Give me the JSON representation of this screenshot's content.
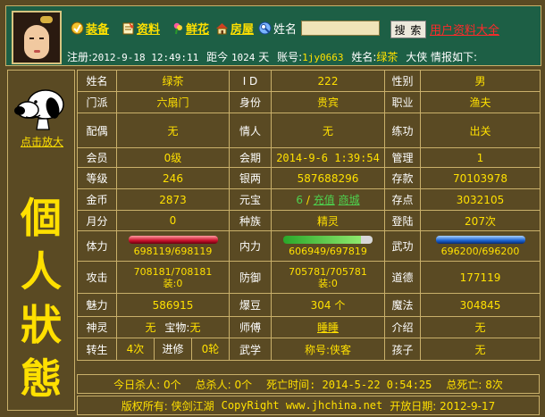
{
  "nav": [
    {
      "label": "装备",
      "icon": "equipment-icon"
    },
    {
      "label": "资料",
      "icon": "profile-icon"
    },
    {
      "label": "鲜花",
      "icon": "flower-icon"
    },
    {
      "label": "房屋",
      "icon": "house-icon"
    }
  ],
  "search": {
    "label": "姓名",
    "button": "搜 索",
    "link": "用户资料大全"
  },
  "reg": {
    "prefix": "注册:",
    "date": "2012-9-18 12:49:11",
    "since": "距今",
    "days": "1024",
    "days_unit": "天",
    "account_label": "账号:",
    "account": "1jy0663",
    "name_label": "姓名:",
    "name": "绿茶",
    "suffix": "大侠 情报如下:"
  },
  "sidebar": {
    "enlarge": "点击放大",
    "title": [
      "個",
      "人",
      "狀",
      "態"
    ]
  },
  "rows": [
    {
      "cells": [
        {
          "l": "姓名",
          "v": "绿茶"
        },
        {
          "l": "I D",
          "v": "222"
        },
        {
          "l": "性别",
          "v": "男"
        }
      ]
    },
    {
      "cells": [
        {
          "l": "门派",
          "v": "六扇门"
        },
        {
          "l": "身份",
          "v": "贵宾"
        },
        {
          "l": "职业",
          "v": "渔夫"
        }
      ]
    },
    {
      "cells": [
        {
          "l": "配偶",
          "v": "无"
        },
        {
          "l": "情人",
          "v": "无"
        },
        {
          "l": "练功",
          "v": "出关"
        }
      ]
    },
    {
      "cells": [
        {
          "l": "会员",
          "v": "0级"
        },
        {
          "l": "会期",
          "v": "2014-9-6 1:39:54"
        },
        {
          "l": "管理",
          "v": "1"
        }
      ]
    },
    {
      "cells": [
        {
          "l": "等级",
          "v": "246"
        },
        {
          "l": "银两",
          "v": "587688296"
        },
        {
          "l": "存款",
          "v": "70103978"
        }
      ]
    },
    {
      "cells": [
        {
          "l": "金币",
          "v": "2873"
        },
        {
          "l": "元宝",
          "v": "6"
        },
        {
          "l": "存点",
          "v": "3032105"
        }
      ]
    },
    {
      "cells": [
        {
          "l": "月分",
          "v": "0"
        },
        {
          "l": "种族",
          "v": "精灵"
        },
        {
          "l": "登陆",
          "v": "207次"
        }
      ]
    }
  ],
  "yuanbao_links": {
    "recharge": "充值",
    "mall": "商城"
  },
  "bars": [
    {
      "label": "体力",
      "current": 698119,
      "max": 698119,
      "text": "698119/698119",
      "color": "#c8102a"
    },
    {
      "label": "内力",
      "current": 606949,
      "max": 697819,
      "text": "606949/697819",
      "color": "#4ed24e"
    },
    {
      "label": "武功",
      "current": 696200,
      "max": 696200,
      "text": "696200/696200",
      "color": "#1a62d0"
    }
  ],
  "rows2": [
    {
      "cells": [
        {
          "l": "攻击",
          "v": "708181/708181",
          "v2": "装:0"
        },
        {
          "l": "防御",
          "v": "705781/705781",
          "v2": "装:0"
        },
        {
          "l": "道德",
          "v": "177119"
        }
      ]
    },
    {
      "cells": [
        {
          "l": "魅力",
          "v": "586915"
        },
        {
          "l": "爆豆",
          "v": "304 个"
        },
        {
          "l": "魔法",
          "v": "304845"
        }
      ]
    }
  ],
  "spirit": {
    "label": "神灵",
    "value": "无",
    "treasure_label": "宝物:",
    "treasure": "无",
    "master_label": "师傅",
    "master": "睡睡",
    "intro_label": "介绍",
    "intro": "无"
  },
  "rebirth": {
    "label": "转生",
    "value": "4次",
    "advance_label": "进修",
    "advance": "0轮",
    "martial_label": "武学",
    "title_label": "称号:",
    "title": "侠客",
    "child_label": "孩子",
    "child": "无"
  },
  "kills": {
    "today": "今日杀人: 0个",
    "total": "总杀人: 0个",
    "death_time": "死亡时间: 2014-5-22 0:54:25",
    "total_death": "总死亡: 8次"
  },
  "footer": {
    "copyright": "版权所有: 侠剑江湖",
    "site": "CopyRight www.jhchina.net",
    "open": "开放日期: 2012-9-17"
  }
}
